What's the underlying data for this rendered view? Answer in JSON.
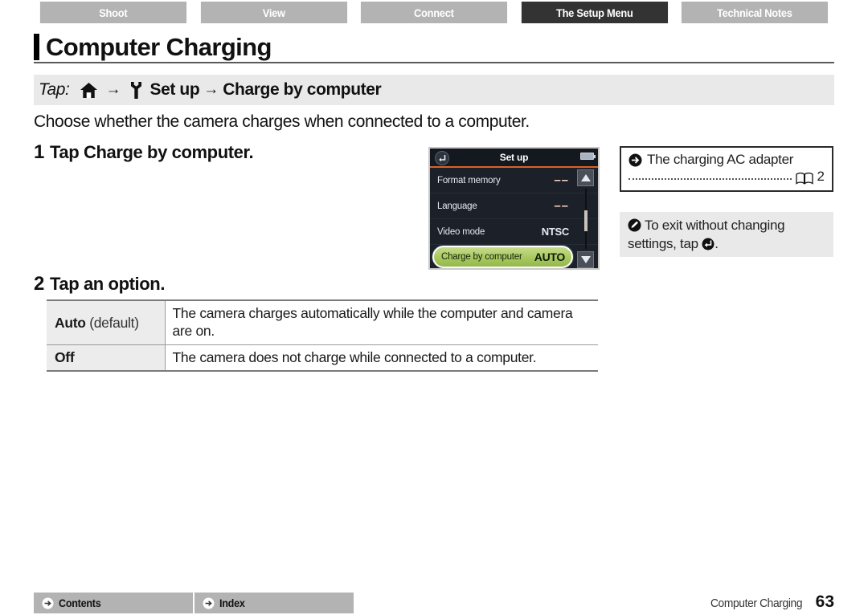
{
  "tabs": [
    {
      "label": "Shoot",
      "active": false
    },
    {
      "label": "View",
      "active": false
    },
    {
      "label": "Connect",
      "active": false
    },
    {
      "label": "The Setup Menu",
      "active": true
    },
    {
      "label": "Technical Notes",
      "active": false
    }
  ],
  "header": {
    "title": "Computer Charging"
  },
  "breadcrumb": {
    "tap_label": "Tap:",
    "home_icon": "home-icon",
    "arrow1": "→",
    "wrench_icon": "wrench-icon",
    "setup_text": "Set up",
    "arrow2": "→",
    "target_text": "Charge by computer"
  },
  "intro": "Choose whether the camera charges when connected to a computer.",
  "steps": [
    {
      "num": "1",
      "text_plain": "Tap ",
      "text_bold": "Charge by computer."
    },
    {
      "num": "2",
      "text_plain": "Tap an option.",
      "text_bold": ""
    }
  ],
  "lcd": {
    "back_icon": "back-arrow-icon",
    "title": "Set up",
    "battery_icon": "battery-icon",
    "rows": [
      {
        "name": "Format memory",
        "value": "––",
        "type": "dash"
      },
      {
        "name": "Language",
        "value": "––",
        "type": "dash"
      },
      {
        "name": "Video mode",
        "value": "NTSC",
        "type": "text"
      }
    ],
    "highlight_row": {
      "name": "Charge by computer",
      "value": "AUTO"
    },
    "scroll_up_icon": "scroll-up-arrow-icon",
    "scroll_down_icon": "scroll-down-arrow-icon"
  },
  "notes": [
    {
      "icon": "right-arrow-circle-icon",
      "text": "The charging AC adapter",
      "book_icon": "book-icon",
      "page_ref": "2"
    },
    {
      "icon": "pencil-note-icon",
      "text_part1": "To exit without changing settings, tap ",
      "inline_icon": "back-arrow-icon",
      "text_part2": "."
    }
  ],
  "options_table": {
    "rows": [
      {
        "key": "Auto",
        "key_sub": " (default)",
        "desc": "The camera charges automatically while the computer and camera are on."
      },
      {
        "key": "Off",
        "key_sub": "",
        "desc": "The camera does not charge while connected to a computer."
      }
    ]
  },
  "footer": {
    "buttons": [
      {
        "label": "Contents",
        "icon": "arrow-circle-icon"
      },
      {
        "label": "Index",
        "icon": "arrow-circle-icon"
      }
    ],
    "section_title": "Computer Charging",
    "page_number": "63"
  },
  "colors": {
    "tab_inactive": "#b3b3b3",
    "tab_active": "#333333",
    "band_gray": "#e9e9e9",
    "lcd_bg": "#1b2029",
    "lcd_accent": "#d9622a",
    "highlight_green": "#a8c85e"
  }
}
